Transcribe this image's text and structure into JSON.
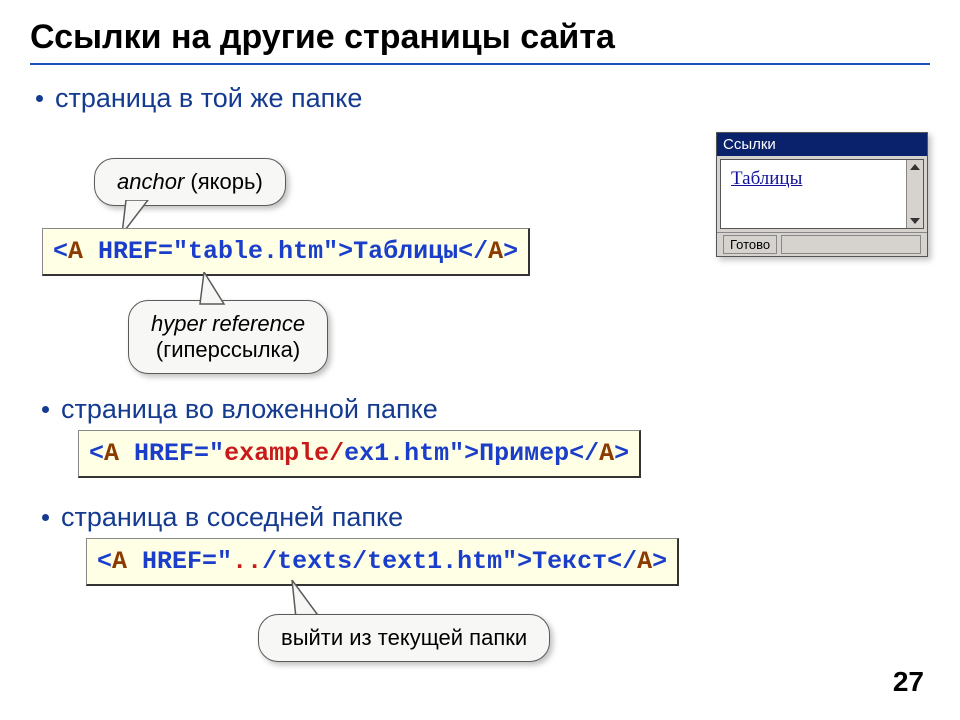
{
  "title": "Ссылки на другие страницы сайта",
  "bullets": [
    "страница в той же папке",
    "страница во вложенной папке",
    "страница в соседней папке"
  ],
  "callouts": {
    "anchor_it": "anchor",
    "anchor_plain": " (якорь)",
    "hyper_it": "hyper reference",
    "hyper_plain": "(гиперссылка)",
    "exit": "выйти из текущей папки"
  },
  "code1": {
    "open1": "<",
    "tagA1": "A",
    "href1": " HREF=",
    "url1": "\"table.htm\"",
    "close1": ">",
    "text1": "Таблицы",
    "open2": "</",
    "tagA2": "A",
    "close2": ">"
  },
  "code2": {
    "open1": "<",
    "tagA1": "A",
    "href1": " HREF=\"",
    "folder": "example/",
    "rest": "ex1.htm\">",
    "text1": "Пример",
    "open2": "</",
    "tagA2": "A",
    "close2": ">"
  },
  "code3": {
    "open1": "<",
    "tagA1": "A",
    "href1": " HREF=\"",
    "dots": "..",
    "rest": "/texts/text1.htm\">",
    "text1": "Текст",
    "open2": "</",
    "tagA2": "A",
    "close2": ">"
  },
  "mini": {
    "title": "Ссылки",
    "linktext": "Таблицы",
    "status": "Готово"
  },
  "pagenum": "27"
}
